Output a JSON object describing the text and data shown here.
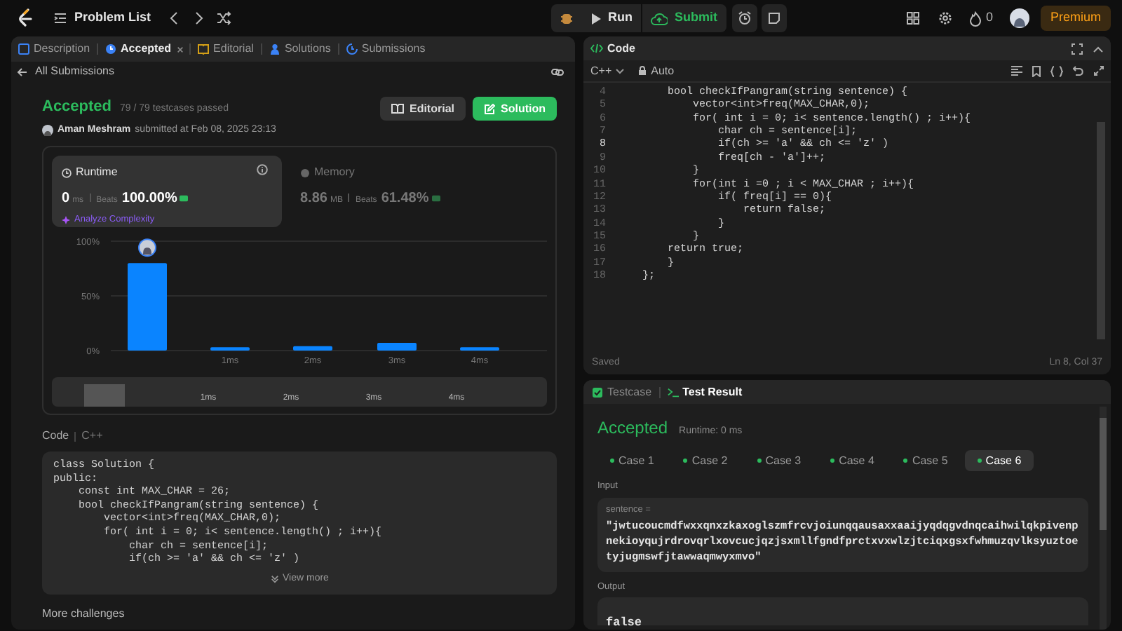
{
  "top_bar": {
    "nav_title": "Problem List",
    "run_label": "Run",
    "submit_label": "Submit",
    "streak_count": "0",
    "premium_label": "Premium"
  },
  "left_panel": {
    "tabs": [
      {
        "label": "Description",
        "selected": false,
        "closable": false
      },
      {
        "label": "Accepted",
        "selected": true,
        "closable": true
      },
      {
        "label": "Editorial",
        "selected": false,
        "closable": false
      },
      {
        "label": "Solutions",
        "selected": false,
        "closable": false
      },
      {
        "label": "Submissions",
        "selected": false,
        "closable": false
      }
    ],
    "back_link": "All Submissions",
    "result": {
      "status": "Accepted",
      "testcases": "79 / 79 testcases passed",
      "author": "Aman Meshram",
      "submitted": "submitted at Feb 08, 2025 23:13"
    },
    "buttons": [
      {
        "label": "Editorial",
        "kind": "secondary"
      },
      {
        "label": "Solution",
        "kind": "primary"
      }
    ],
    "stats": [
      {
        "title": "Runtime",
        "value": "0",
        "unit": "ms",
        "beats_label": "Beats",
        "beats": "100.00%",
        "selected": true
      },
      {
        "title": "Memory",
        "value": "8.86",
        "unit": "MB",
        "beats_label": "Beats",
        "beats": "61.48%",
        "selected": false
      }
    ],
    "analyze_link": "Analyze Complexity",
    "chart_data": {
      "type": "bar",
      "categories": [
        null,
        "1ms",
        "2ms",
        "3ms",
        "4ms"
      ],
      "series": [
        {
          "color": "#0a84ff",
          "values": [
            80,
            3,
            4,
            7,
            3
          ]
        }
      ],
      "ylim": [
        0,
        100
      ],
      "yticks": [
        {
          "value": 0,
          "label": "0%"
        },
        {
          "value": 50,
          "label": "50%"
        },
        {
          "value": 100,
          "label": "100%"
        }
      ]
    },
    "navigator_labels": [
      "1ms",
      "2ms",
      "3ms",
      "4ms"
    ],
    "code_header": {
      "label": "Code",
      "language": "C++"
    },
    "code_lines": [
      "class Solution {",
      "public:",
      "    const int MAX_CHAR = 26;",
      "    bool checkIfPangram(string sentence) {",
      "        vector<int>freq(MAX_CHAR,0);",
      "        for( int i = 0; i< sentence.length() ; i++){",
      "            char ch = sentence[i];",
      "            if(ch >= 'a' && ch <= 'z' )"
    ],
    "view_more": "View more",
    "more_challenges": "More challenges"
  },
  "editor": {
    "title": "Code",
    "language": "C++",
    "mode": "Auto",
    "lines": [
      {
        "number": "4",
        "text": "    bool checkIfPangram(string sentence) {",
        "selected": false
      },
      {
        "number": "5",
        "text": "        vector<int>freq(MAX_CHAR,0);",
        "selected": false
      },
      {
        "number": "6",
        "text": "        for( int i = 0; i< sentence.length() ; i++){",
        "selected": false
      },
      {
        "number": "7",
        "text": "            char ch = sentence[i];",
        "selected": false
      },
      {
        "number": "8",
        "text": "            if(ch >= 'a' && ch <= 'z' )",
        "selected": true
      },
      {
        "number": "9",
        "text": "            freq[ch - 'a']++;",
        "selected": false
      },
      {
        "number": "10",
        "text": "        }",
        "selected": false
      },
      {
        "number": "11",
        "text": "        for(int i =0 ; i < MAX_CHAR ; i++){",
        "selected": false
      },
      {
        "number": "12",
        "text": "            if( freq[i] == 0){",
        "selected": false
      },
      {
        "number": "13",
        "text": "                return false;",
        "selected": false
      },
      {
        "number": "14",
        "text": "            }",
        "selected": false
      },
      {
        "number": "15",
        "text": "        }",
        "selected": false
      },
      {
        "number": "16",
        "text": "    return true;",
        "selected": false
      },
      {
        "number": "17",
        "text": "    }",
        "selected": false
      },
      {
        "number": "18",
        "text": "};",
        "selected": false
      }
    ],
    "status": "Saved",
    "cursor": "Ln 8, Col 37"
  },
  "test_panel": {
    "tabs": [
      {
        "label": "Testcase",
        "selected": false
      },
      {
        "label": "Test Result",
        "selected": true
      }
    ],
    "status": "Accepted",
    "runtime": "Runtime: 0 ms",
    "cases": [
      {
        "label": "Case 1",
        "selected": false
      },
      {
        "label": "Case 2",
        "selected": false
      },
      {
        "label": "Case 3",
        "selected": false
      },
      {
        "label": "Case 4",
        "selected": false
      },
      {
        "label": "Case 5",
        "selected": false
      },
      {
        "label": "Case 6",
        "selected": true
      }
    ],
    "input_label": "Input",
    "param_label": "sentence =",
    "param_value": "\"jwtucoucmdfwxxqnxzkaxoglszmfrcvjoiunqqausaxxaaijyqdqgvdnqcaihwilqkpivenpnekioyqujrdrovqrlxovcucjqzjsxmllfgndfprctxvxwlzjtciqxgsxfwhmuzqvlksyuztoetyjugmswfjtawwaqmwyxmvo\"",
    "output_label": "Output",
    "output_value": "false"
  }
}
